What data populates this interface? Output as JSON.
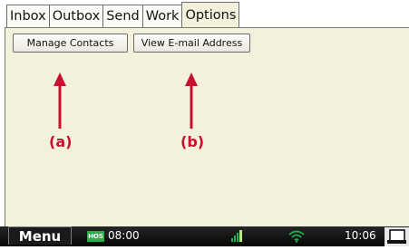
{
  "tabs": [
    {
      "label": "Inbox",
      "active": false
    },
    {
      "label": "Outbox",
      "active": false
    },
    {
      "label": "Send",
      "active": false
    },
    {
      "label": "Work",
      "active": false
    },
    {
      "label": "Options",
      "active": true
    }
  ],
  "options": {
    "manage_contacts_label": "Manage Contacts",
    "view_email_label": "View E-mail Address"
  },
  "annotations": {
    "a": "(a)",
    "b": "(b)",
    "color": "#c8102e"
  },
  "taskbar": {
    "menu_label": "Menu",
    "hos_badge": "HOS",
    "hos_time": "08:00",
    "clock": "10:06",
    "icons": [
      "hos-icon",
      "signal-icon",
      "wifi-icon",
      "dock-icon"
    ]
  },
  "colors": {
    "panel_background": "#f3f0dc",
    "taskbar_background": "#0a0a0a",
    "hos_green": "#22b14c"
  }
}
